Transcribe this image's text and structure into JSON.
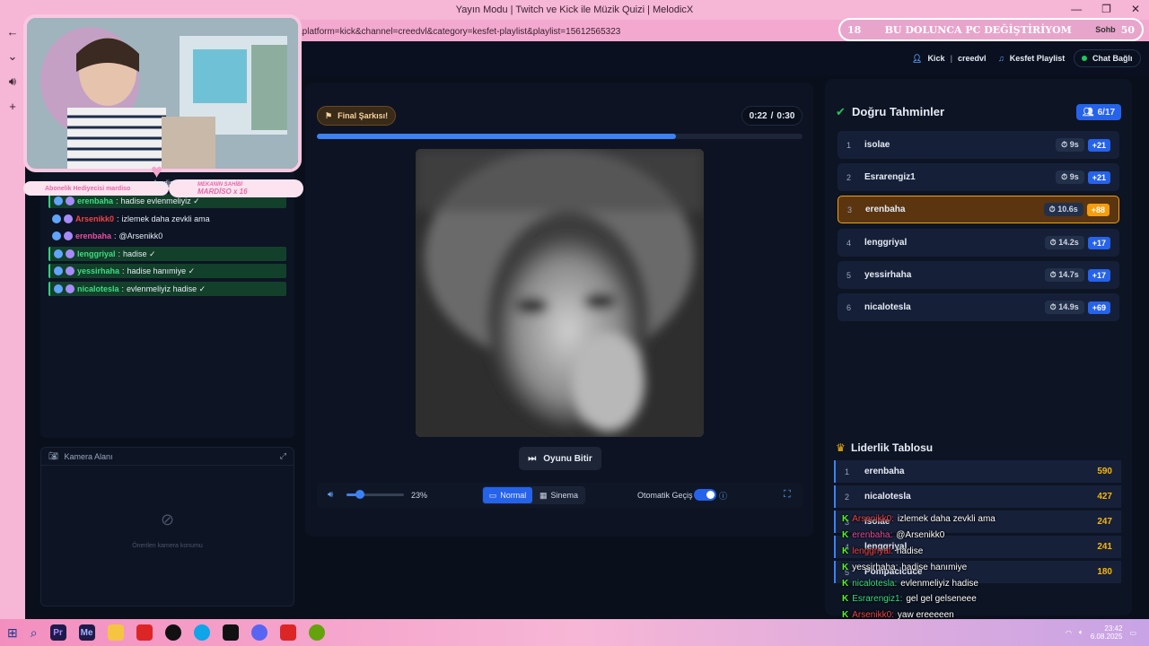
{
  "window": {
    "title": "Yayın Modu | Twitch ve Kick ile Müzik Quizi | MelodicX"
  },
  "address": {
    "url": "&platform=kick&channel=creedvl&category=kesfet-playlist&playlist=15612565323"
  },
  "header": {
    "platform": "Kick",
    "channel": "creedvl",
    "playlist": "Kesfet Playlist",
    "chat_status": "Chat Bağlı"
  },
  "stream_banner": {
    "left_num": "18",
    "text": "BU DOLUNCA PC DEĞİŞTİRİYOM",
    "right_num": "50",
    "tab": "Sohb"
  },
  "webcam": {
    "sub_label": "Abonelik Hediyecisi mardiso",
    "owner_title": "MEKANIN SAHİBİ",
    "owner_name": "MARDİSO x 16",
    "partial_word": "hadis"
  },
  "player": {
    "final_label": "Final Şarkısı!",
    "time_current": "0:22",
    "time_sep": "/",
    "time_total": "0:30",
    "progress": 0.74,
    "end_button": "Oyunu Bitir",
    "volume_pct": "23%",
    "volume": 0.23,
    "mode_normal": "Normal",
    "mode_cinema": "Sinema",
    "autoplay_label": "Otomatik Geçiş"
  },
  "chat": [
    {
      "user": "erenbaha",
      "color": "#3ddc84",
      "text": "hadise evlenmeliyiz ✓",
      "hl": true
    },
    {
      "user": "Arsenikk0",
      "color": "#ef4444",
      "text": "izlemek daha zevkli ama",
      "hl": false
    },
    {
      "user": "erenbaha",
      "color": "#e84fa3",
      "text": "@Arsenikk0",
      "hl": false
    },
    {
      "user": "lenggriyal",
      "color": "#3ddc84",
      "text": "hadise ✓",
      "hl": true
    },
    {
      "user": "yessirhaha",
      "color": "#3ddc84",
      "text": "hadise hanımiye ✓",
      "hl": true
    },
    {
      "user": "nicalotesla",
      "color": "#3ddc84",
      "text": "evlenmeliyiz hadise ✓",
      "hl": true
    }
  ],
  "camera": {
    "title": "Kamera Alanı",
    "placeholder": "Önerilen kamera konumu"
  },
  "guesses": {
    "title": "Doğru Tahminler",
    "count": "6/17",
    "items": [
      {
        "rank": "1",
        "name": "isolae",
        "time": "9s",
        "points": "+21"
      },
      {
        "rank": "2",
        "name": "Esrarengiz1",
        "time": "9s",
        "points": "+21"
      },
      {
        "rank": "3",
        "name": "erenbaha",
        "time": "10.6s",
        "points": "+88"
      },
      {
        "rank": "4",
        "name": "lenggriyal",
        "time": "14.2s",
        "points": "+17"
      },
      {
        "rank": "5",
        "name": "yessirhaha",
        "time": "14.7s",
        "points": "+17"
      },
      {
        "rank": "6",
        "name": "nicalotesla",
        "time": "14.9s",
        "points": "+69"
      }
    ]
  },
  "leaderboard": {
    "title": "Liderlik Tablosu",
    "items": [
      {
        "rank": "1",
        "name": "erenbaha",
        "score": "590"
      },
      {
        "rank": "2",
        "name": "nicalotesla",
        "score": "427"
      },
      {
        "rank": "3",
        "name": "isolae",
        "score": "247"
      },
      {
        "rank": "4",
        "name": "lenggriyal",
        "score": "241"
      },
      {
        "rank": "5",
        "name": "Pompacicuce",
        "score": "180"
      }
    ]
  },
  "overlay_chat": [
    {
      "user": "Arsenikk0:",
      "color": "#ef4444",
      "text": "izlemek daha zevkli ama"
    },
    {
      "user": "erenbaha:",
      "color": "#e84fa3",
      "text": "@Arsenikk0"
    },
    {
      "user": "lenggriyal:",
      "color": "#ef4444",
      "text": "hadise"
    },
    {
      "user": "yessirhaha:",
      "color": "#ffffff",
      "text": "hadise hanımiye"
    },
    {
      "user": "nicalotesla:",
      "color": "#3ddc84",
      "text": "evlenmeliyiz hadise"
    },
    {
      "user": "Esrarengiz1:",
      "color": "#3ddc84",
      "text": "gel gel gelseneee"
    },
    {
      "user": "Arsenikk0:",
      "color": "#ef4444",
      "text": "yaw ereeeeen"
    }
  ],
  "taskbar": {
    "clock": "23:42",
    "date": "6.08.2025"
  },
  "icons": [
    "back-icon",
    "search-icon",
    "volume-icon",
    "camera-icon",
    "check-circle-icon",
    "crown-icon",
    "clock-icon",
    "skip-icon",
    "fullscreen-icon"
  ]
}
